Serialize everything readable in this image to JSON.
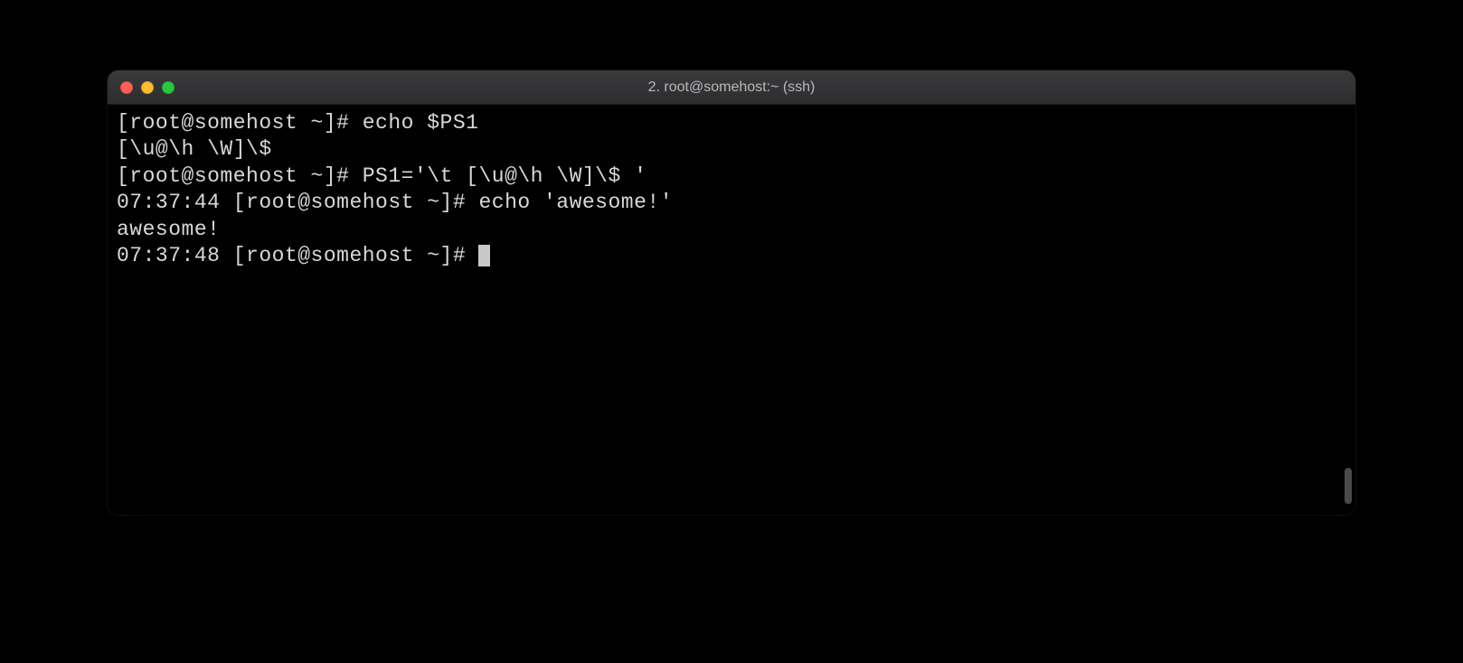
{
  "window": {
    "title": "2. root@somehost:~ (ssh)"
  },
  "terminal": {
    "lines": [
      "[root@somehost ~]# echo $PS1",
      "[\\u@\\h \\W]\\$",
      "[root@somehost ~]# PS1='\\t [\\u@\\h \\W]\\$ '",
      "07:37:44 [root@somehost ~]# echo 'awesome!'",
      "awesome!",
      "07:37:48 [root@somehost ~]# "
    ]
  }
}
